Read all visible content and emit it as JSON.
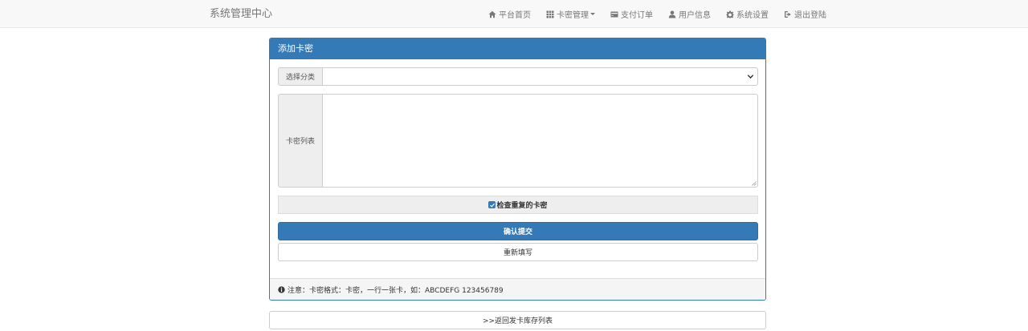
{
  "navbar": {
    "brand": "系统管理中心",
    "items": [
      {
        "label": "平台首页",
        "icon": "home-icon"
      },
      {
        "label": "卡密管理",
        "icon": "grid-icon",
        "dropdown": true
      },
      {
        "label": "支付订单",
        "icon": "credit-card-icon"
      },
      {
        "label": "用户信息",
        "icon": "user-icon"
      },
      {
        "label": "系统设置",
        "icon": "gear-icon"
      },
      {
        "label": "退出登陆",
        "icon": "logout-icon"
      }
    ]
  },
  "panel": {
    "title": "添加卡密",
    "category_label": "选择分类",
    "category_value": "",
    "cards_label": "卡密列表",
    "cards_value": "",
    "cards_placeholder": "",
    "check_duplicates_label": "检查重复的卡密",
    "check_duplicates_checked": true,
    "submit_label": "确认提交",
    "reset_label": "重新填写",
    "note": "注意：卡密格式：卡密，一行一张卡，如：ABCDEFG 123456789"
  },
  "back_link": ">>返回发卡库存列表",
  "colors": {
    "primary": "#337ab7",
    "navbar_bg": "#f8f8f8",
    "addon_bg": "#eeeeee"
  }
}
